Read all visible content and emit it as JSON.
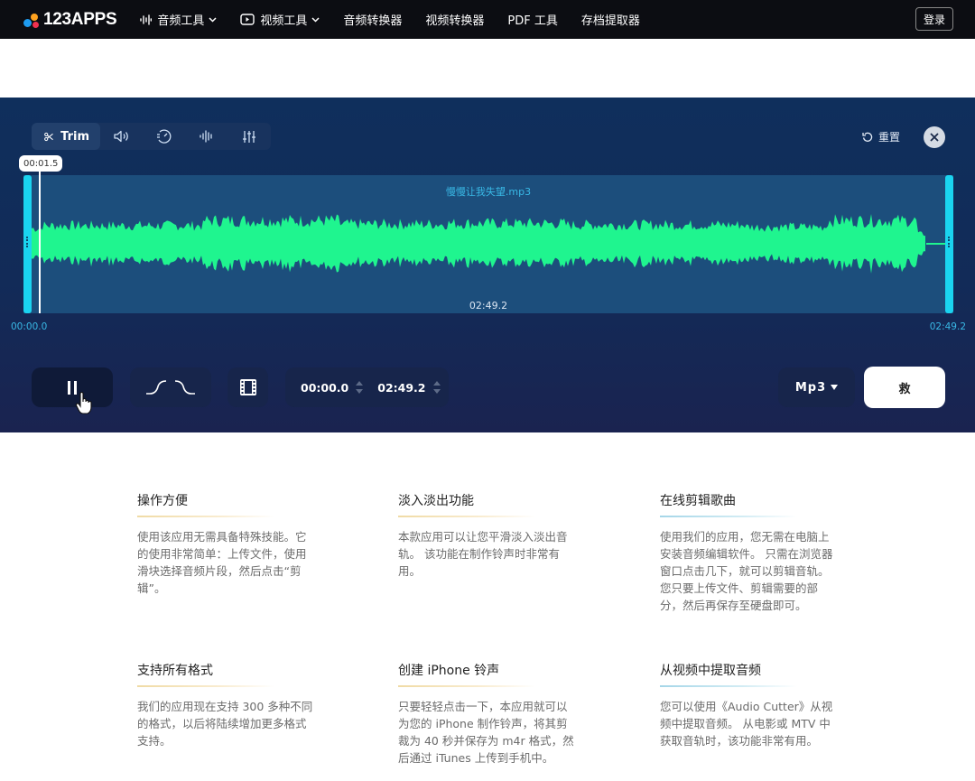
{
  "nav": {
    "logo_text": "123APPS",
    "items": [
      {
        "label": "音频工具",
        "icon": "audio-wave-icon",
        "dropdown": true
      },
      {
        "label": "视频工具",
        "icon": "video-play-icon",
        "dropdown": true
      },
      {
        "label": "音频转换器"
      },
      {
        "label": "视频转换器"
      },
      {
        "label": "PDF 工具"
      },
      {
        "label": "存档提取器"
      }
    ],
    "login_label": "登录"
  },
  "editor": {
    "trim_label": "Trim",
    "reset_label": "重置",
    "file_name": "慢慢让我失望.mp3",
    "duration": "02:49.2",
    "playhead_time": "00:01.5",
    "timeline_start": "00:00.0",
    "timeline_end": "02:49.2",
    "range_start": "00:00.0",
    "range_end": "02:49.2",
    "format_label": "Mp3",
    "save_label": "救",
    "colors": {
      "waveform": "#1ff58f",
      "handle": "#1ad4f0",
      "panel": "#0f2f5c"
    }
  },
  "features": [
    {
      "title": "操作方便",
      "text": "使用该应用无需具备特殊技能。它的使用非常简单：上传文件，使用滑块选择音频片段，然后点击“剪辑”。"
    },
    {
      "title": "淡入淡出功能",
      "text": "本款应用可以让您平滑淡入淡出音轨。 该功能在制作铃声时非常有用。"
    },
    {
      "title": "在线剪辑歌曲",
      "text": "使用我们的应用，您无需在电脑上安装音频编辑软件。 只需在浏览器窗口点击几下，就可以剪辑音轨。 您只要上传文件、剪辑需要的部分，然后再保存至硬盘即可。"
    },
    {
      "title": "支持所有格式",
      "text": "我们的应用现在支持 300 多种不同的格式，以后将陆续增加更多格式支持。"
    },
    {
      "title": "创建 iPhone 铃声",
      "text": "只要轻轻点击一下，本应用就可以为您的 iPhone 制作铃声，将其剪裁为 40 秒并保存为 m4r 格式，然后通过 iTunes 上传到手机中。"
    },
    {
      "title": "从视频中提取音频",
      "text": "您可以使用《Audio Cutter》从视频中提取音频。 从电影或 MTV 中获取音轨时，该功能非常有用。"
    }
  ]
}
